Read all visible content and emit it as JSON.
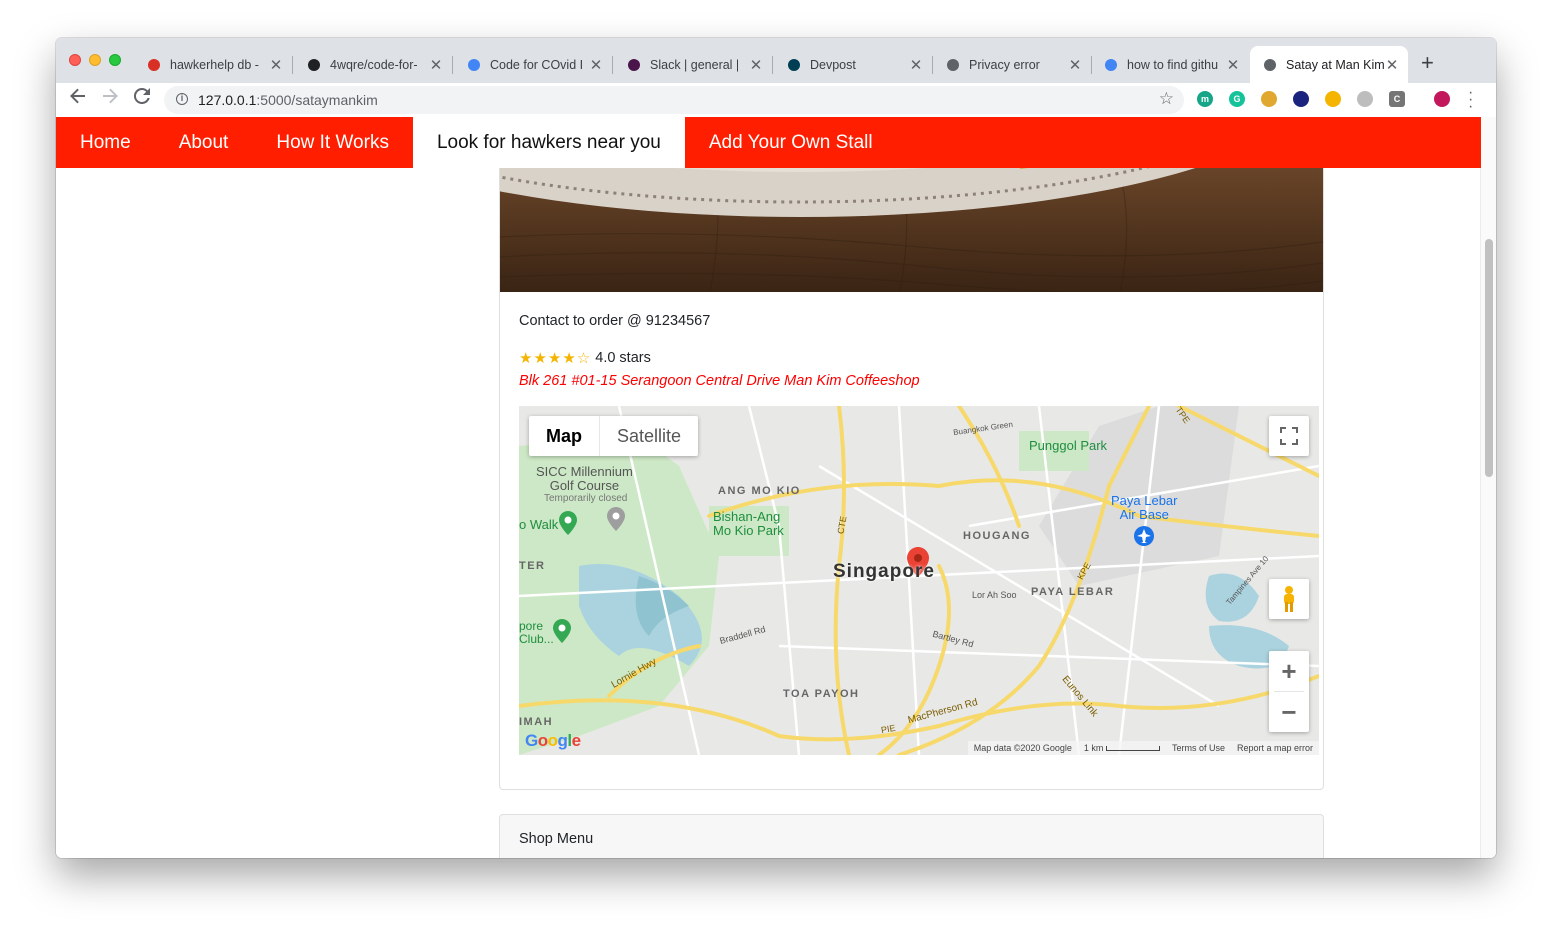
{
  "browser": {
    "tabs": [
      {
        "title": "hawkerhelp db -",
        "icon": "gmail-icon",
        "color": "#d93025"
      },
      {
        "title": "4wqre/code-for-",
        "icon": "github-icon",
        "color": "#202124"
      },
      {
        "title": "Code for COvid I",
        "icon": "docs-icon",
        "color": "#4285f4"
      },
      {
        "title": "Slack | general |",
        "icon": "slack-icon",
        "color": "#4a154b"
      },
      {
        "title": "Devpost",
        "icon": "devpost-icon",
        "color": "#003e54"
      },
      {
        "title": "Privacy error",
        "icon": "globe-icon",
        "color": "#5f6368"
      },
      {
        "title": "how to find githu",
        "icon": "google-icon",
        "color": "#4285f4"
      },
      {
        "title": "Satay at Man Kim",
        "icon": "globe-icon",
        "color": "#5f6368"
      }
    ],
    "close_glyph": "✕",
    "new_tab_glyph": "+",
    "url_host": "127.0.0.1",
    "url_path": ":5000/sataymankim",
    "extensions": [
      {
        "name": "m-extension-icon",
        "label": "m",
        "color": "#17a589"
      },
      {
        "name": "grammarly-icon",
        "label": "G",
        "color": "#15c39a"
      },
      {
        "name": "burger-extension-icon",
        "label": "",
        "color": "#e0a82e"
      },
      {
        "name": "cursor-extension-icon",
        "label": "",
        "color": "#1a237e"
      },
      {
        "name": "face-extension-icon",
        "label": "",
        "color": "#f4b400"
      },
      {
        "name": "grey-extension-icon",
        "label": "",
        "color": "#bdbdbd"
      },
      {
        "name": "c-extension-icon",
        "label": "C",
        "color": "#757575"
      },
      {
        "name": "people-extension-icon",
        "label": "",
        "color": "#c2185b"
      }
    ]
  },
  "nav": {
    "items": [
      "Home",
      "About",
      "How It Works",
      "Look for hawkers near you",
      "Add Your Own Stall"
    ],
    "active_index": 3,
    "color": "#ff1f00"
  },
  "stall": {
    "contact": "Contact to order @ 91234567",
    "stars_glyph": "★★★★☆",
    "rating": 4.0,
    "rating_text": "4.0 stars",
    "address": "Blk 261 #01-15 Serangoon Central Drive Man Kim Coffeeshop"
  },
  "map": {
    "types": [
      "Map",
      "Satellite"
    ],
    "selected_type": "Map",
    "center_label": "Singapore",
    "labels": {
      "punggol": "Punggol Park",
      "paya_lebar_air": "Paya Lebar\nAir Base",
      "sicc": "SICC Millennium\nGolf Course",
      "temp_closed": "Temporarily closed",
      "ang_mo_kio": "ANG MO KIO",
      "bishan": "Bishan-Ang\nMo Kio Park",
      "hougang": "HOUGANG",
      "paya_lebar": "PAYA LEBAR",
      "toa_payoh": "TOA PAYOH",
      "lornie": "Lornie Hwy",
      "walk": "o Walk",
      "ter": "TER",
      "club": "pore\nClub...",
      "imah": "IMAH",
      "macpherson": "MacPherson Rd",
      "kpe": "KPE",
      "cte": "CTE",
      "pie": "PIE",
      "tpe": "TPE",
      "eunos": "Eunos Link",
      "lor_ah_soo": "Lor Ah Soo",
      "bartley": "Bartley Rd",
      "braddell": "Braddell Rd",
      "buangkok": "Buangkok Green",
      "tampines": "Tampines Ave 10"
    },
    "footer": {
      "data": "Map data ©2020 Google",
      "scale": "1 km",
      "terms": "Terms of Use",
      "report": "Report a map error"
    },
    "google": "Google",
    "zoom_in": "+",
    "zoom_out": "−"
  },
  "shop_menu": {
    "title": "Shop Menu"
  }
}
